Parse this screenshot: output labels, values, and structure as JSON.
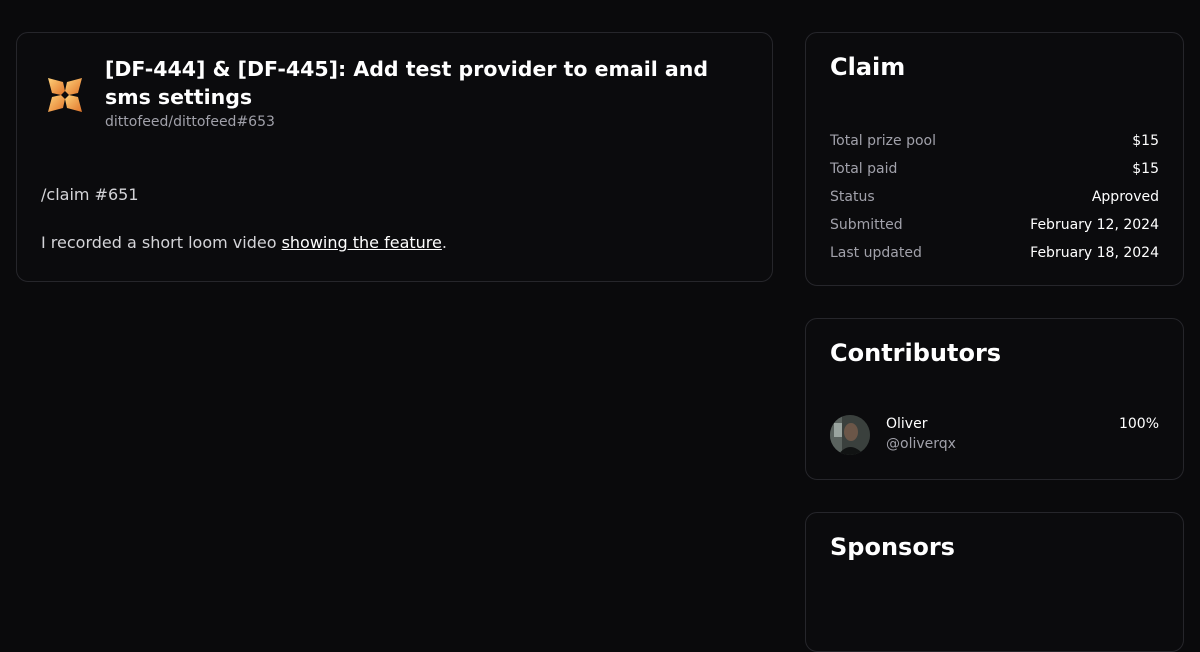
{
  "pr": {
    "title": "[DF-444] & [DF-445]: Add test provider to email and sms settings",
    "ref": "dittofeed/dittofeed#653",
    "body_line1": "/claim #651",
    "body_line2_prefix": "I recorded a short loom video ",
    "body_link": "showing the feature",
    "body_line2_suffix": "."
  },
  "claim": {
    "heading": "Claim",
    "rows": [
      {
        "label": "Total prize pool",
        "value": "$15"
      },
      {
        "label": "Total paid",
        "value": "$15"
      },
      {
        "label": "Status",
        "value": "Approved"
      },
      {
        "label": "Submitted",
        "value": "February 12, 2024"
      },
      {
        "label": "Last updated",
        "value": "February 18, 2024"
      }
    ]
  },
  "contributors": {
    "heading": "Contributors",
    "items": [
      {
        "name": "Oliver",
        "handle": "@oliverqx",
        "share": "100%"
      }
    ]
  },
  "sponsors": {
    "heading": "Sponsors"
  },
  "colors": {
    "background": "#0a0a0c",
    "border": "#26262b",
    "muted_text": "#a1a1aa",
    "logo_orange": "#f5a84a"
  }
}
